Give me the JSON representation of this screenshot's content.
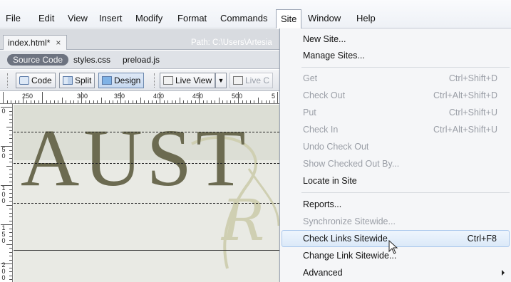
{
  "menubar": {
    "items": [
      {
        "label": "File"
      },
      {
        "label": "Edit"
      },
      {
        "label": "View"
      },
      {
        "label": "Insert"
      },
      {
        "label": "Modify"
      },
      {
        "label": "Format"
      },
      {
        "label": "Commands"
      },
      {
        "label": "Site"
      },
      {
        "label": "Window"
      },
      {
        "label": "Help"
      }
    ]
  },
  "document": {
    "tab_label": "index.html*",
    "close_glyph": "×",
    "path_text": "Path:  C:\\Users\\Artesia"
  },
  "related_files": {
    "items": [
      {
        "label": "Source Code"
      },
      {
        "label": "styles.css"
      },
      {
        "label": "preload.js"
      }
    ]
  },
  "toolbar": {
    "code_label": "Code",
    "split_label": "Split",
    "design_label": "Design",
    "liveview_label": "Live View",
    "livecode_label": "Live C"
  },
  "ruler": {
    "h_numbers": [
      "250",
      "300",
      "350",
      "400",
      "450",
      "500",
      "5"
    ],
    "v_numbers": [
      "0",
      "5 0",
      "1 0 0",
      "1 5 0",
      "2 0 0"
    ]
  },
  "canvas": {
    "hero_text": "AUST",
    "script_text": "R"
  },
  "site_menu": {
    "items": [
      {
        "label": "New Site...",
        "shortcut": "",
        "state": "enabled"
      },
      {
        "label": "Manage Sites...",
        "shortcut": "",
        "state": "enabled"
      },
      {
        "label": "Get",
        "shortcut": "Ctrl+Shift+D",
        "state": "disabled"
      },
      {
        "label": "Check Out",
        "shortcut": "Ctrl+Alt+Shift+D",
        "state": "disabled"
      },
      {
        "label": "Put",
        "shortcut": "Ctrl+Shift+U",
        "state": "disabled"
      },
      {
        "label": "Check In",
        "shortcut": "Ctrl+Alt+Shift+U",
        "state": "disabled"
      },
      {
        "label": "Undo Check Out",
        "shortcut": "",
        "state": "disabled"
      },
      {
        "label": "Show Checked Out By...",
        "shortcut": "",
        "state": "disabled"
      },
      {
        "label": "Locate in Site",
        "shortcut": "",
        "state": "enabled"
      },
      {
        "label": "Reports...",
        "shortcut": "",
        "state": "enabled"
      },
      {
        "label": "Synchronize Sitewide...",
        "shortcut": "",
        "state": "disabled"
      },
      {
        "label": "Check Links Sitewide",
        "shortcut": "Ctrl+F8",
        "state": "highlighted"
      },
      {
        "label": "Change Link Sitewide...",
        "shortcut": "",
        "state": "enabled"
      },
      {
        "label": "Advanced",
        "shortcut": "",
        "state": "submenu"
      }
    ]
  }
}
